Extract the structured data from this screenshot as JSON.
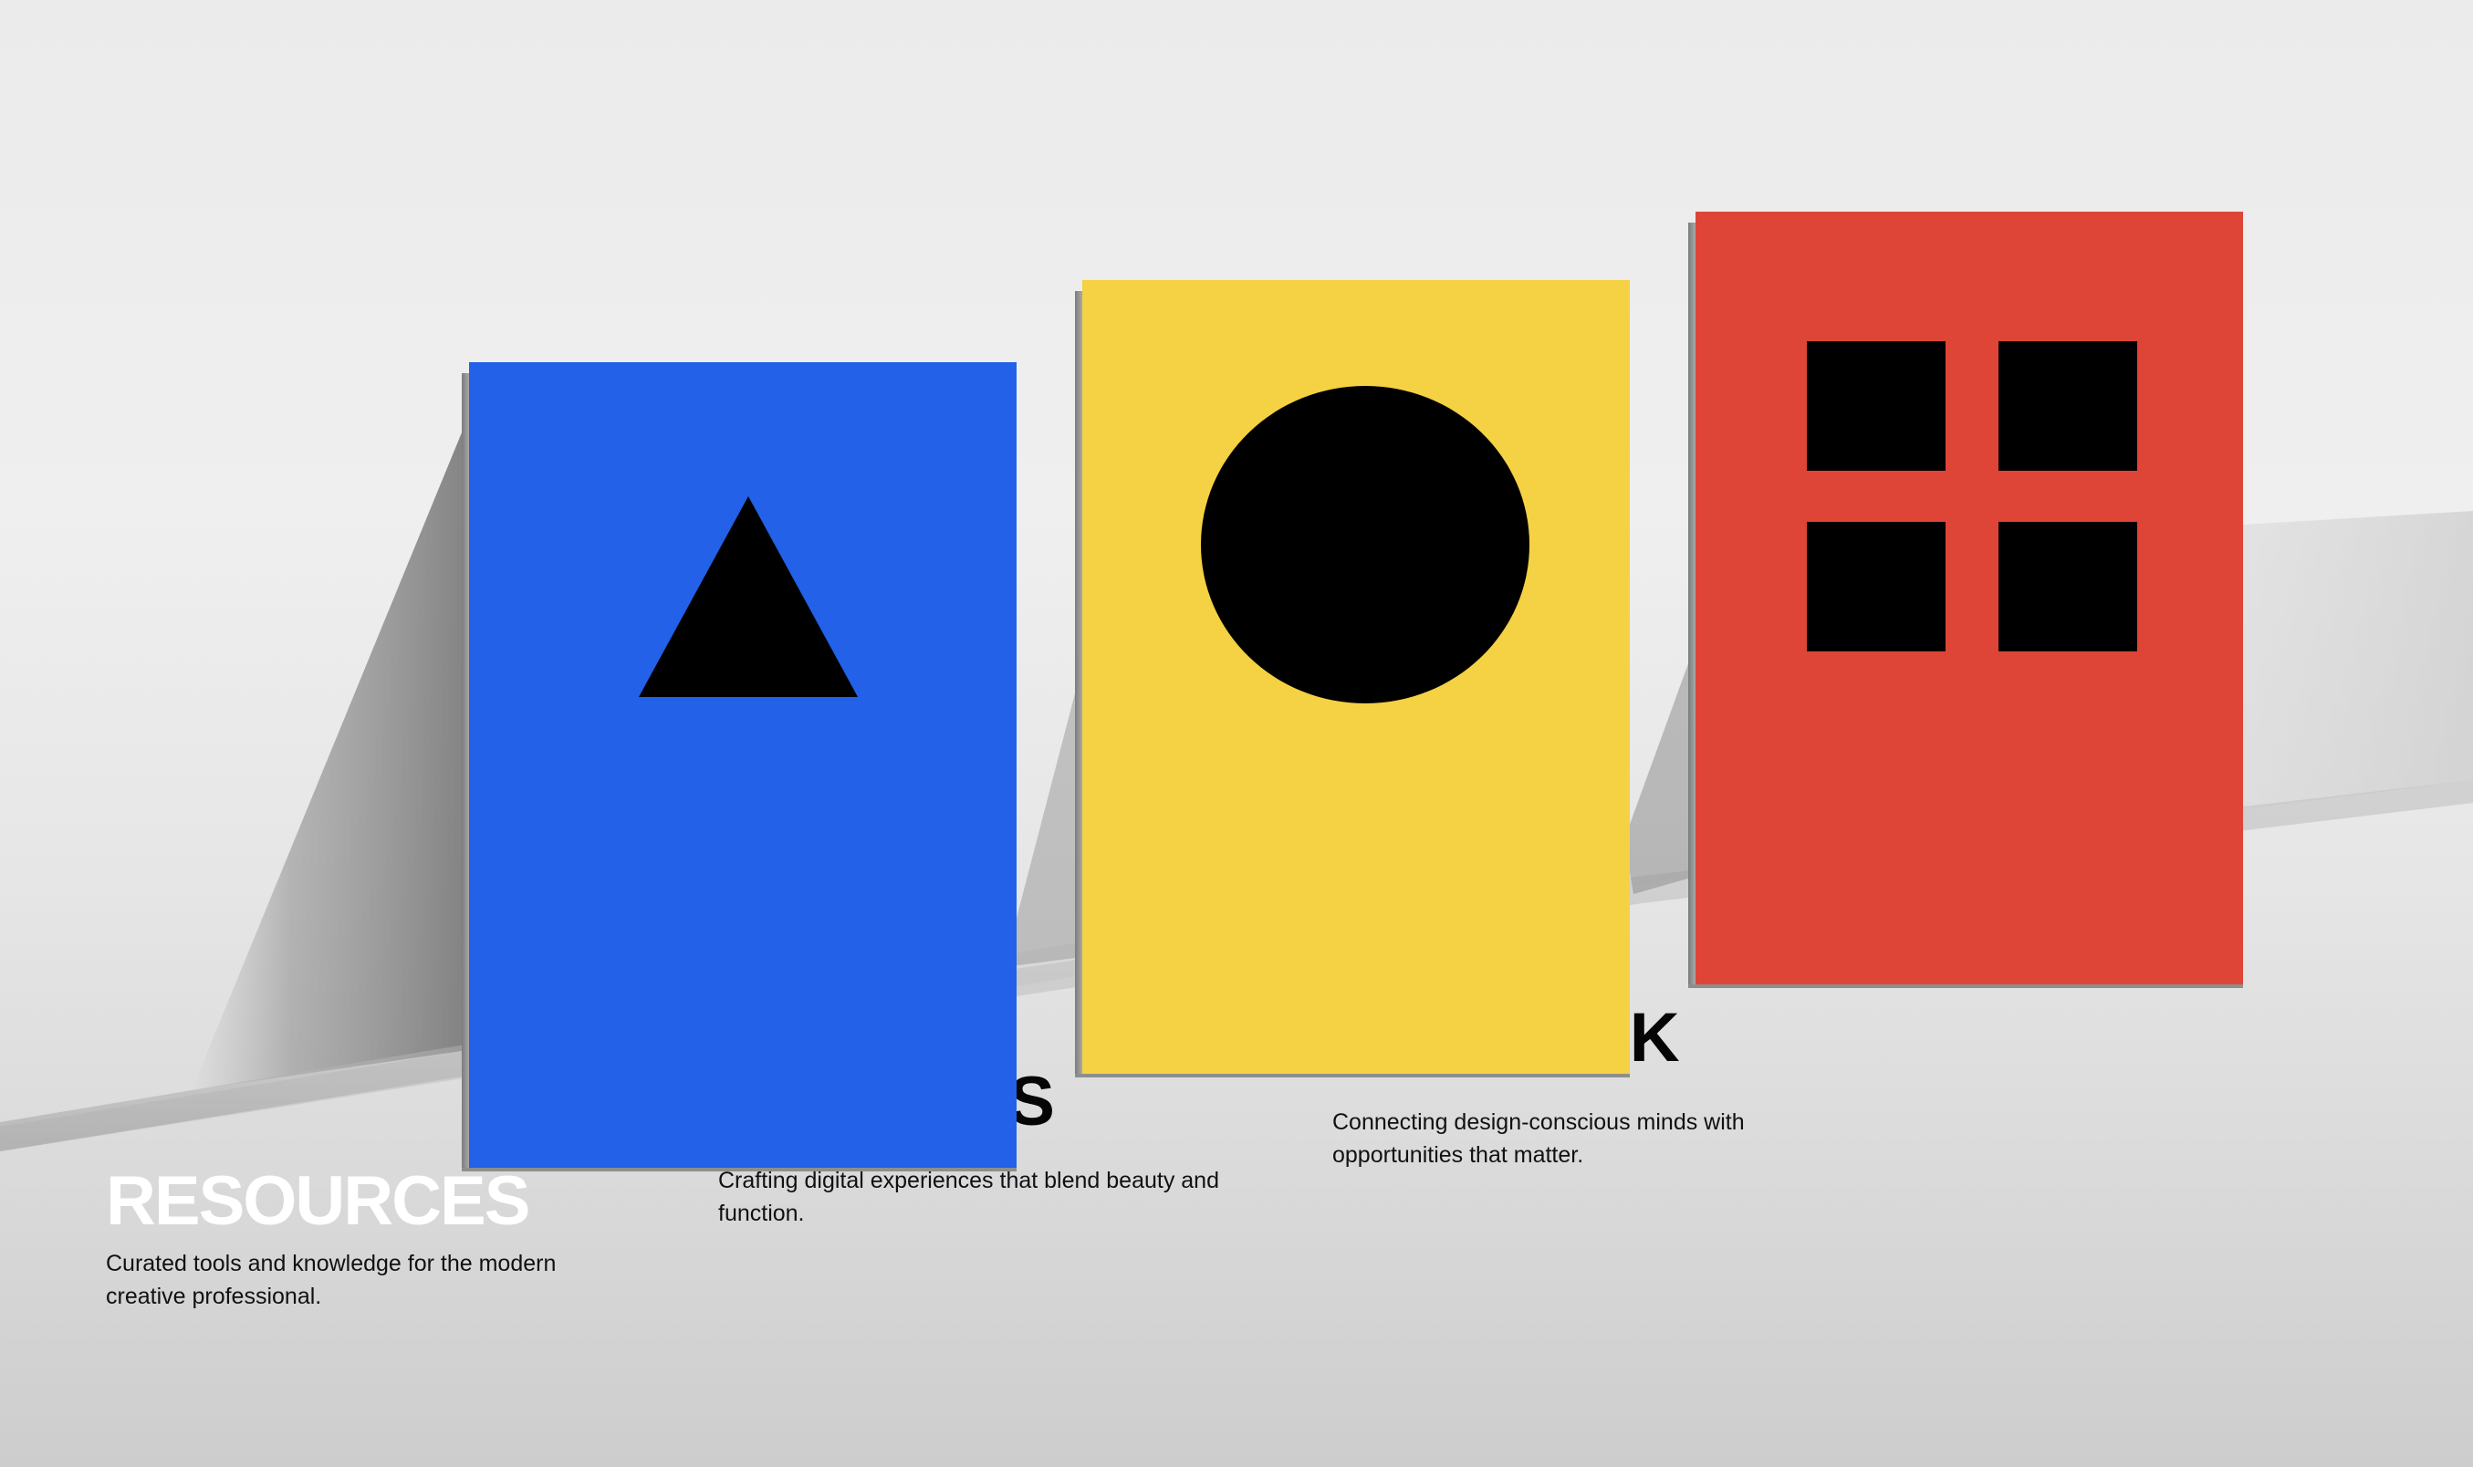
{
  "colors": {
    "background": "#ebebeb",
    "blue_card": "#2261e8",
    "yellow_card": "#f5d144",
    "red_card": "#de4536",
    "glyph": "#000000"
  },
  "cards": [
    {
      "name": "resources",
      "color": "#2261e8",
      "glyph_icon": "triangle-icon",
      "title": "RESOURCES",
      "description": "Curated tools and knowledge for the modern creative professional."
    },
    {
      "name": "services",
      "color": "#f5d144",
      "glyph_icon": "circle-icon",
      "title": "SERVICES",
      "description": "Crafting digital experiences that blend beauty and function."
    },
    {
      "name": "network",
      "color": "#de4536",
      "glyph_icon": "four-squares-grid-icon",
      "title": "NETWORK",
      "description": "Connecting design-conscious minds with opportunities that matter."
    }
  ]
}
